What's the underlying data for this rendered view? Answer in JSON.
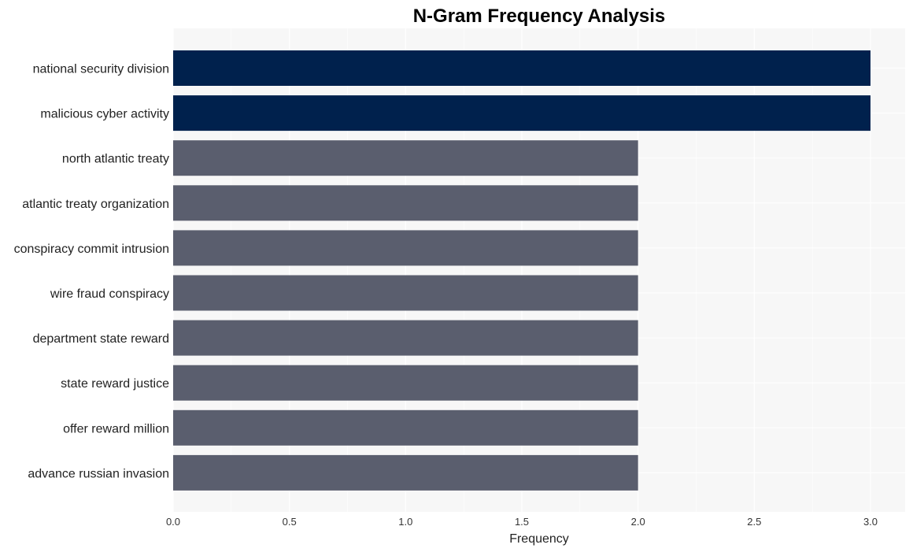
{
  "chart_data": {
    "type": "bar",
    "orientation": "horizontal",
    "title": "N-Gram Frequency Analysis",
    "xlabel": "Frequency",
    "ylabel": "",
    "xlim": [
      0,
      3.15
    ],
    "xticks": [
      "0.0",
      "0.5",
      "1.0",
      "1.5",
      "2.0",
      "2.5",
      "3.0"
    ],
    "xtick_values": [
      0,
      0.5,
      1.0,
      1.5,
      2.0,
      2.5,
      3.0
    ],
    "grid": true,
    "categories": [
      "national security division",
      "malicious cyber activity",
      "north atlantic treaty",
      "atlantic treaty organization",
      "conspiracy commit intrusion",
      "wire fraud conspiracy",
      "department state reward",
      "state reward justice",
      "offer reward million",
      "advance russian invasion"
    ],
    "values": [
      3,
      3,
      2,
      2,
      2,
      2,
      2,
      2,
      2,
      2
    ],
    "colors": {
      "highlight": "#00214d",
      "default": "#5a5e6e",
      "plot_background": "#f7f7f7",
      "grid": "#ffffff"
    }
  }
}
